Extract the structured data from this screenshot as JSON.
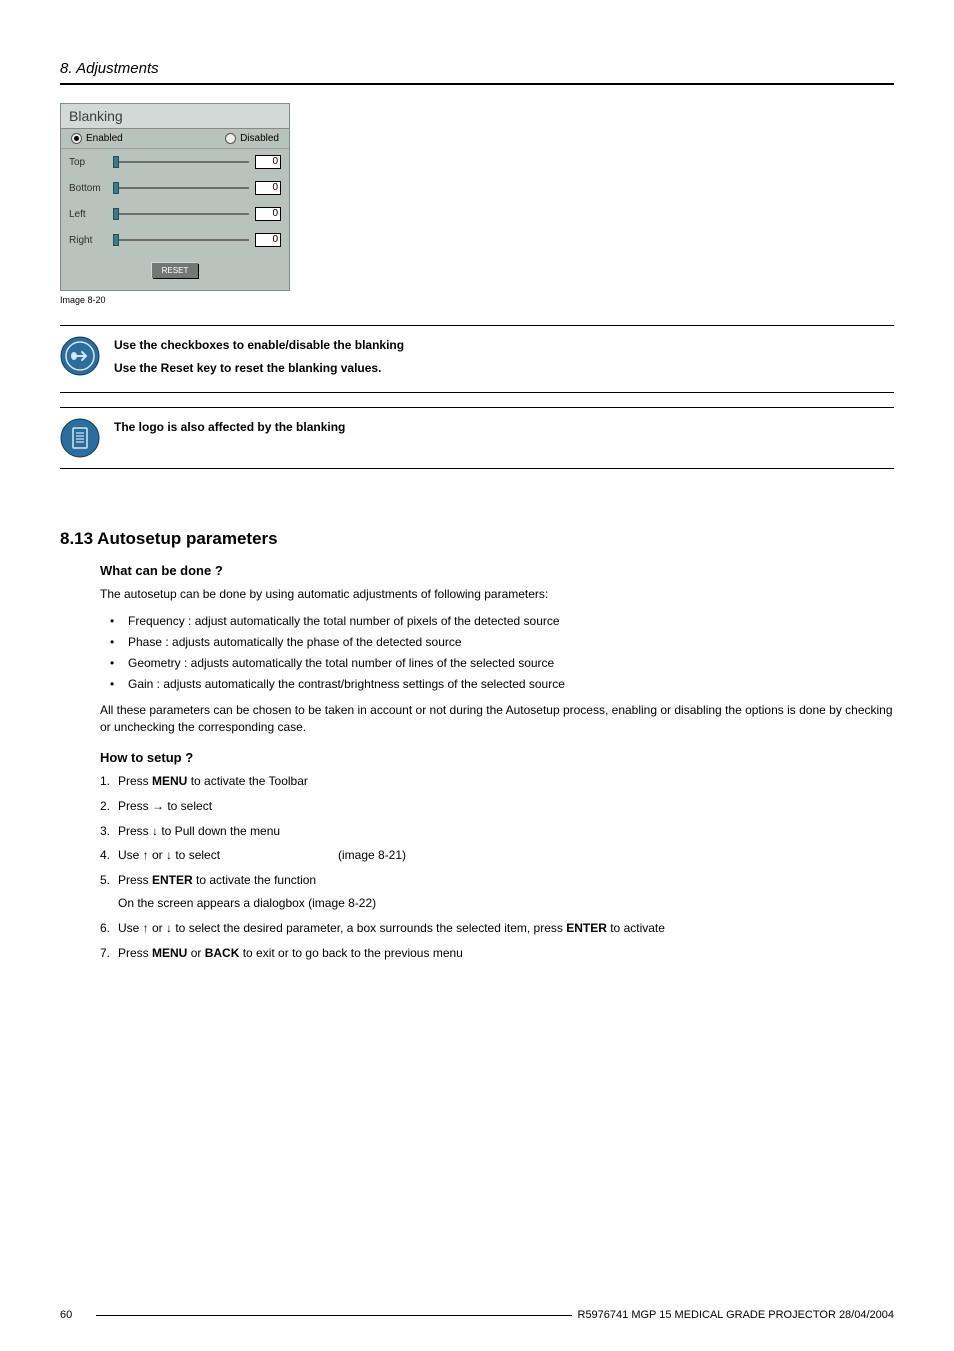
{
  "header": {
    "title": "8. Adjustments"
  },
  "blanking": {
    "title": "Blanking",
    "enabled_label": "Enabled",
    "disabled_label": "Disabled",
    "rows": {
      "top": {
        "label": "Top",
        "value": "0"
      },
      "bottom": {
        "label": "Bottom",
        "value": "0"
      },
      "left": {
        "label": "Left",
        "value": "0"
      },
      "right": {
        "label": "Right",
        "value": "0"
      }
    },
    "reset_label": "RESET",
    "caption": "Image 8-20"
  },
  "note1": {
    "line1": "Use the checkboxes to enable/disable the blanking",
    "line2": "Use the Reset key to reset the blanking values."
  },
  "note2": {
    "line1": "The logo is also affected by the blanking"
  },
  "section": {
    "title": "8.13 Autosetup parameters",
    "sub1": "What can be done ?",
    "intro": "The autosetup can be done by using automatic adjustments of following parameters:",
    "bullets": {
      "b1": "Frequency : adjust automatically the total number of pixels of the detected source",
      "b2": "Phase : adjusts automatically the phase of the detected source",
      "b3": "Geometry : adjusts automatically the total number of lines of the selected source",
      "b4": "Gain : adjusts automatically the contrast/brightness settings of the selected source"
    },
    "after_bullets": "All these parameters can be chosen to be taken in account or not during the Autosetup process, enabling or disabling the options is done by checking or unchecking the corresponding case.",
    "sub2": "How to setup ?",
    "steps": {
      "s1a": "Press ",
      "s1b": "MENU",
      "s1c": " to activate the Toolbar",
      "s2": "Press → to select",
      "s3": "Press ↓ to Pull down the menu",
      "s4a": "Use ↑ or ↓ to select",
      "s4b": "(image 8-21)",
      "s5a": "Press ",
      "s5b": "ENTER",
      "s5c": " to activate the function",
      "s5sub": "On the screen appears a dialogbox (image 8-22)",
      "s6a": "Use ↑ or ↓ to select the desired parameter, a box surrounds the selected item, press ",
      "s6b": "ENTER",
      "s6c": " to activate",
      "s7a": "Press ",
      "s7b": "MENU",
      "s7c": " or ",
      "s7d": "BACK",
      "s7e": " to exit or to go back to the previous menu"
    }
  },
  "footer": {
    "page": "60",
    "text": "R5976741  MGP 15 MEDICAL GRADE PROJECTOR  28/04/2004"
  }
}
